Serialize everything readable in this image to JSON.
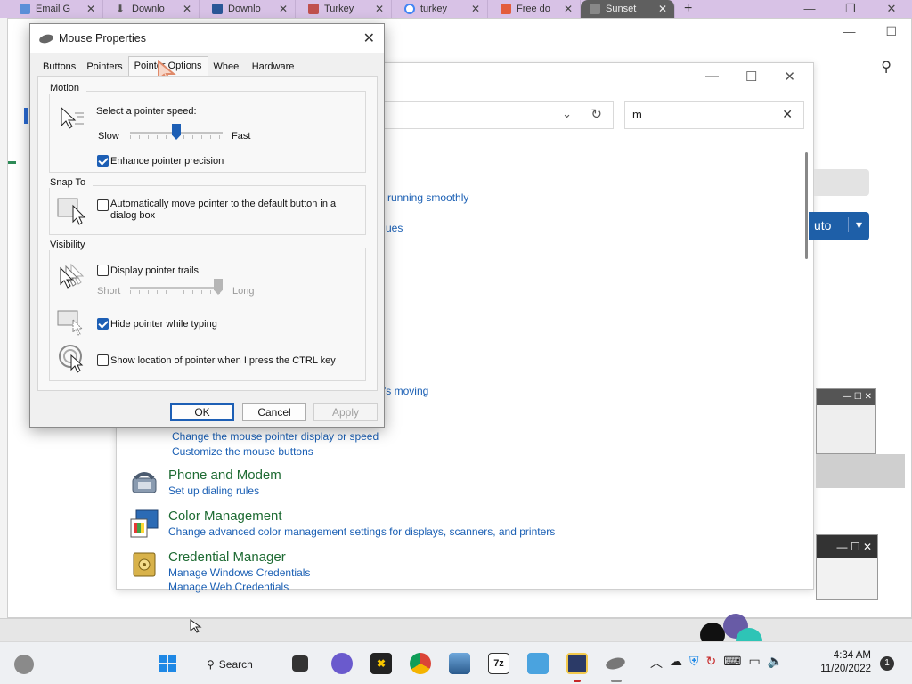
{
  "browser": {
    "tabs": [
      {
        "label": "Email G",
        "color": "#5b8fd8"
      },
      {
        "label": "Downlo",
        "color": "#777777"
      },
      {
        "label": "Downlo",
        "color": "#2b5797"
      },
      {
        "label": "Turkey",
        "color": "#c0504d"
      },
      {
        "label": "turkey",
        "color": "#4285f4"
      },
      {
        "label": "Free do",
        "color": "#e35d3b"
      },
      {
        "label": "Sunset",
        "color": "#888888"
      }
    ],
    "new_tab": "+"
  },
  "control_panel": {
    "search_value": "m",
    "fragments": {
      "running": "running smoothly",
      "ues": "ues",
      "moving": "'s moving"
    },
    "mouse_links": [
      "Change the mouse pointer display or speed",
      "Customize the mouse buttons"
    ],
    "items": [
      {
        "title": "Phone and Modem",
        "links": [
          "Set up dialing rules"
        ]
      },
      {
        "title": "Color Management",
        "links": [
          "Change advanced color management settings for displays, scanners, and printers"
        ]
      },
      {
        "title": "Credential Manager",
        "links": [
          "Manage Windows Credentials",
          "Manage Web Credentials"
        ]
      }
    ],
    "side_button": "uto"
  },
  "dialog": {
    "title": "Mouse Properties",
    "tabs": [
      "Buttons",
      "Pointers",
      "Pointer Options",
      "Wheel",
      "Hardware"
    ],
    "active_tab": "Pointer Options",
    "motion": {
      "group": "Motion",
      "label": "Select a pointer speed:",
      "slow": "Slow",
      "fast": "Fast",
      "speed_fraction": 0.5,
      "enhance_label": "Enhance pointer precision",
      "enhance_checked": true
    },
    "snap": {
      "group": "Snap To",
      "label_line1": "Automatically move pointer to the default button in a",
      "label_line2": "dialog box",
      "checked": false
    },
    "visibility": {
      "group": "Visibility",
      "trails_label": "Display pointer trails",
      "trails_checked": false,
      "short": "Short",
      "long": "Long",
      "trail_fraction": 1.0,
      "hide_label": "Hide pointer while typing",
      "hide_checked": true,
      "ctrl_label": "Show location of pointer when I press the CTRL key",
      "ctrl_checked": false
    },
    "buttons": {
      "ok": "OK",
      "cancel": "Cancel",
      "apply": "Apply"
    }
  },
  "taskbar": {
    "search": "Search",
    "time": "4:34 AM",
    "date": "11/20/2022",
    "notifications": "1"
  },
  "colors": {
    "accent": "#1d5fb5",
    "link": "#1a5fb4",
    "cp_title": "#1e6b33"
  }
}
